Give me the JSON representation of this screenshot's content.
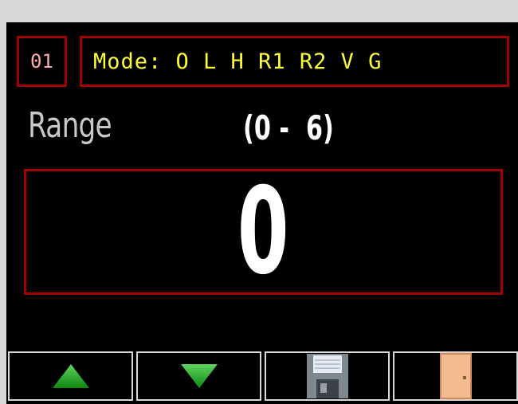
{
  "header": {
    "id_label": "01",
    "mode_label": "Mode: O L H R1 R2 V G"
  },
  "range": {
    "label": "Range",
    "limits": "(0 -  6)"
  },
  "value": {
    "current": "0"
  },
  "buttons": [
    {
      "name": "up-button",
      "icon": "up-arrow-icon"
    },
    {
      "name": "down-button",
      "icon": "down-arrow-icon"
    },
    {
      "name": "save-button",
      "icon": "floppy-disk-icon"
    },
    {
      "name": "exit-button",
      "icon": "door-icon"
    }
  ],
  "colors": {
    "frame_red": "#a00000",
    "mode_text": "#ffff33",
    "id_text": "#ffaaaa",
    "arrow_green": "#22aa22"
  }
}
